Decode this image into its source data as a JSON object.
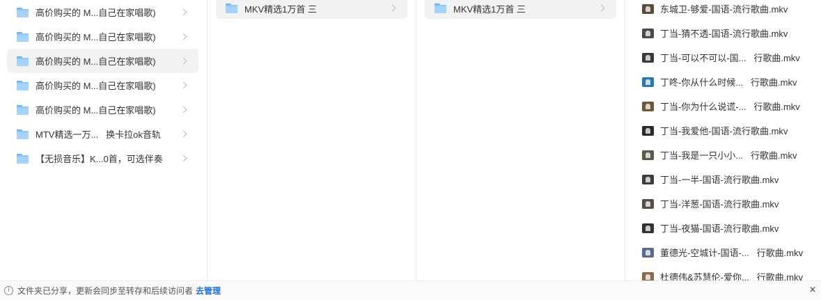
{
  "column1": {
    "items": [
      {
        "label": "高价购买的 M...自己在家唱歌)",
        "icon": "folder-icon"
      },
      {
        "label": "高价购买的 M...自己在家唱歌)",
        "icon": "folder-icon"
      },
      {
        "label": "高价购买的 M...自己在家唱歌)",
        "icon": "folder-icon",
        "selected": true
      },
      {
        "label": "高价购买的 M...自己在家唱歌)",
        "icon": "folder-icon"
      },
      {
        "label": "高价购买的 M...自己在家唱歌)",
        "icon": "folder-icon"
      },
      {
        "label": "MTV精选一万...   换卡拉ok音轨",
        "icon": "folder-icon"
      },
      {
        "label": "【无损音乐】K...0首，可选伴奏",
        "icon": "folder-icon"
      }
    ]
  },
  "column2": {
    "items": [
      {
        "label": "MKV精选1万首 三",
        "icon": "folder-icon",
        "selected": true
      }
    ]
  },
  "column3": {
    "items": [
      {
        "label": "MKV精选1万首 三",
        "icon": "folder-icon",
        "selected": true
      }
    ]
  },
  "column4": {
    "files": [
      {
        "label": "东城卫-够爱-国语-流行歌曲.mkv",
        "thumb_color": "#5a4a3a"
      },
      {
        "label": "丁当-猜不透-国语-流行歌曲.mkv",
        "thumb_color": "#4a4a4a"
      },
      {
        "label": "丁当-可以不可以-国...   行歌曲.mkv",
        "thumb_color": "#3a3a3a"
      },
      {
        "label": "丁咚-你从什么时候...   行歌曲.mkv",
        "thumb_color": "#2a7ab0"
      },
      {
        "label": "丁当-你为什么说谎-...   行歌曲.mkv",
        "thumb_color": "#6a5a3a"
      },
      {
        "label": "丁当-我爱他-国语-流行歌曲.mkv",
        "thumb_color": "#2e2a2a"
      },
      {
        "label": "丁当-我是一只小小...   行歌曲.mkv",
        "thumb_color": "#5a5a4a"
      },
      {
        "label": "丁当-一半-国语-流行歌曲.mkv",
        "thumb_color": "#3e3e3e"
      },
      {
        "label": "丁当-洋葱-国语-流行歌曲.mkv",
        "thumb_color": "#5a4e46"
      },
      {
        "label": "丁当-夜猫-国语-流行歌曲.mkv",
        "thumb_color": "#333333"
      },
      {
        "label": "董德光-空城计-国语-...   行歌曲.mkv",
        "thumb_color": "#5a6a8a"
      },
      {
        "label": "杜德伟&苏慧伦-爱你...   行歌曲.mkv",
        "thumb_color": "#8a6a4a"
      }
    ]
  },
  "footer": {
    "info_icon": "info-icon",
    "message": "文件夹已分享，更新会同步至转存和后续访问者",
    "manage_link": "去管理",
    "close_icon": "close-icon",
    "close_glyph": "×",
    "info_glyph": "i"
  }
}
